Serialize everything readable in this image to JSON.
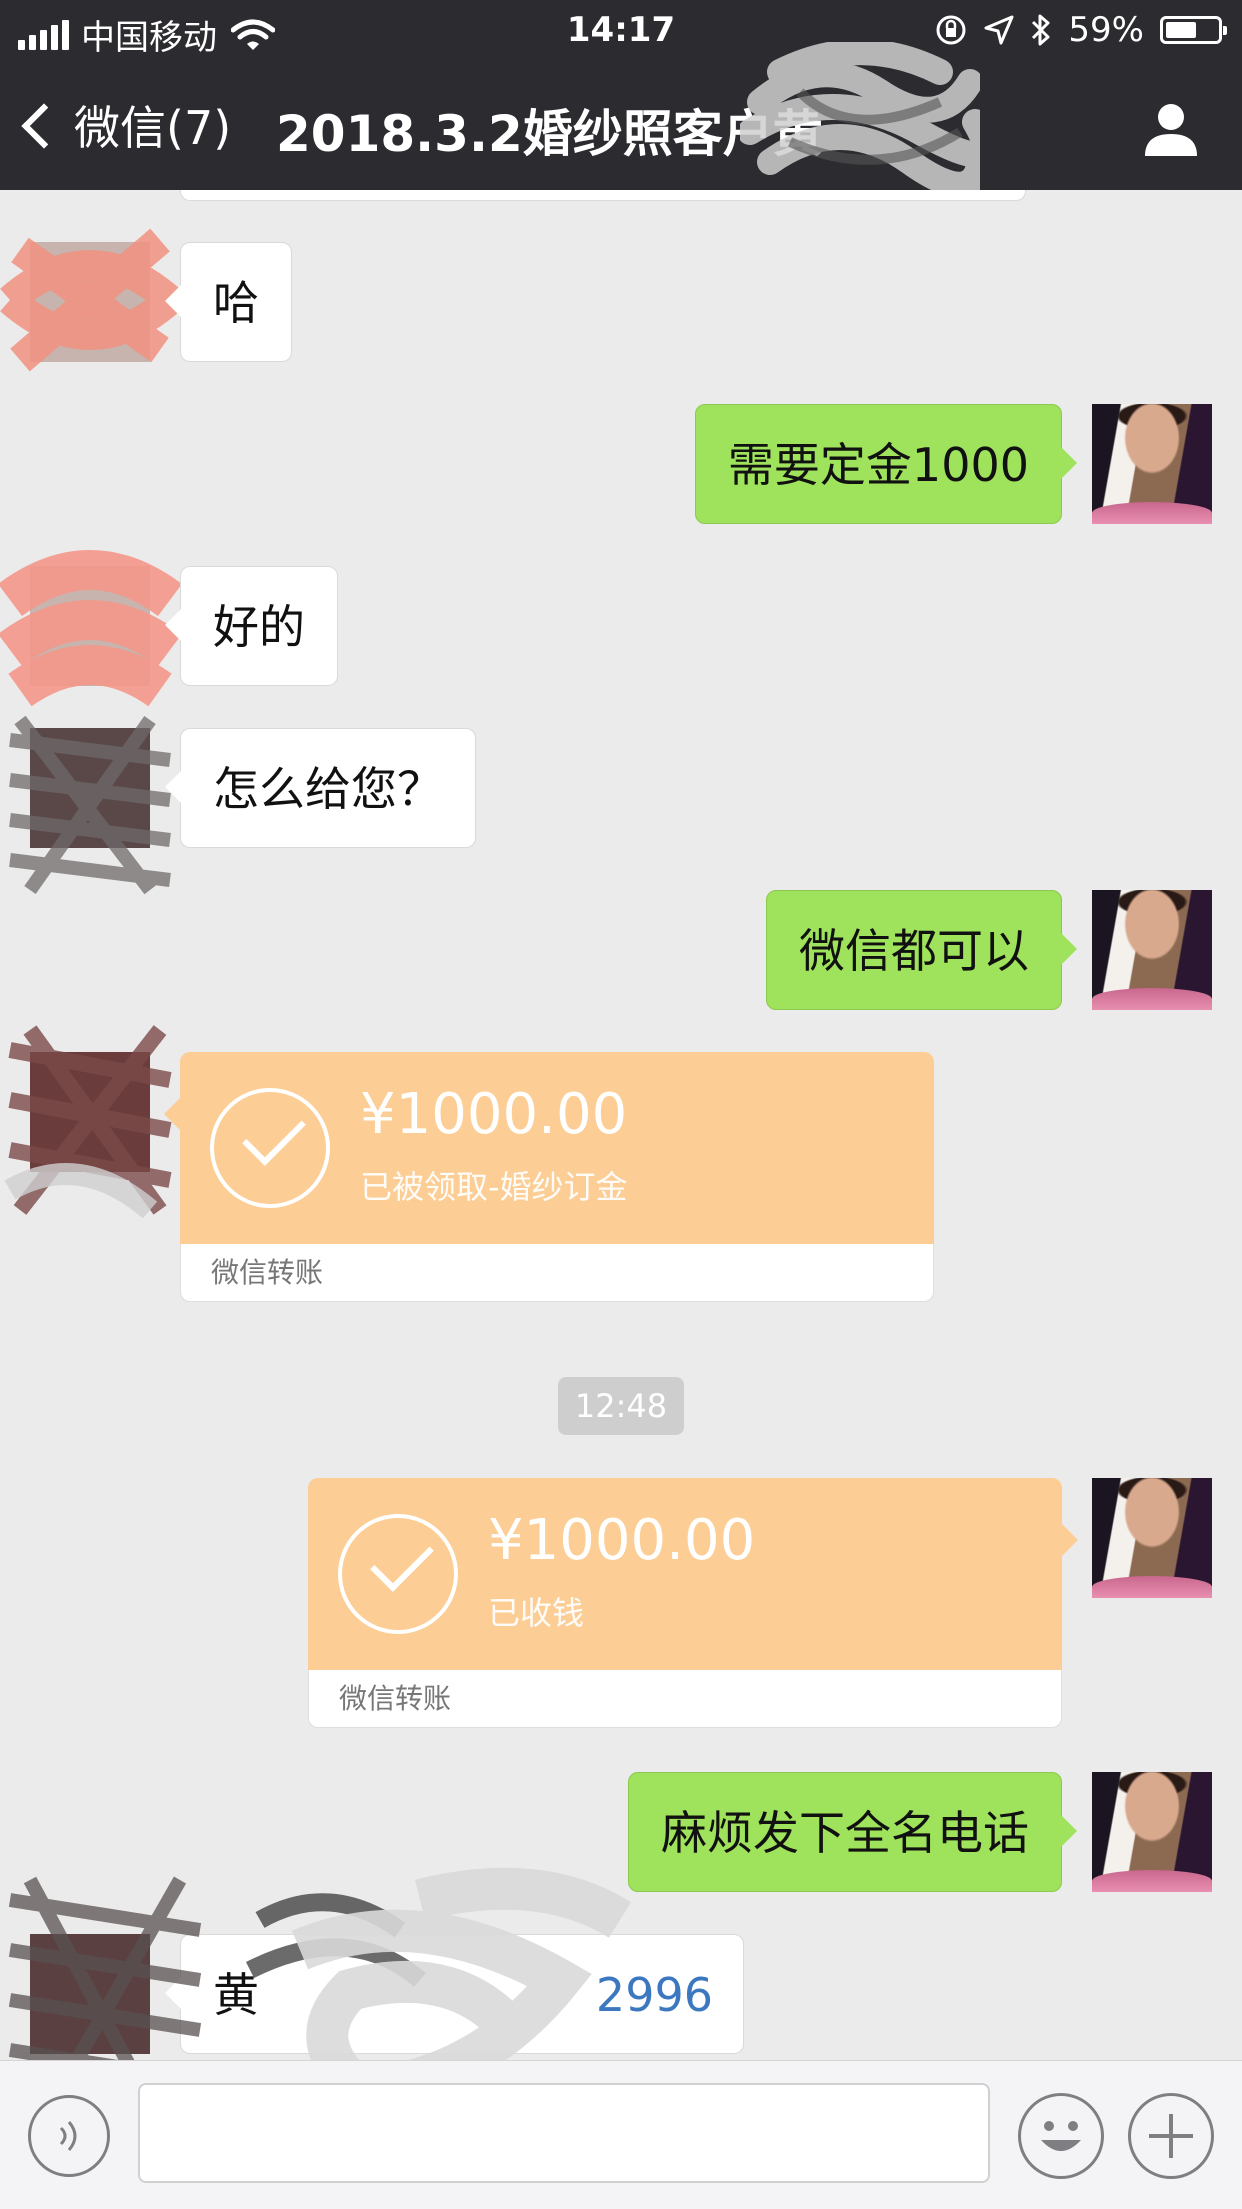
{
  "status_bar": {
    "carrier": "中国移动",
    "time": "14:17",
    "battery_percent": "59%",
    "battery_level": 0.59,
    "icons": [
      "signal-icon",
      "wifi-icon",
      "orientation-lock-icon",
      "location-arrow-icon",
      "bluetooth-icon",
      "battery-icon"
    ]
  },
  "nav": {
    "back_label": "微信(7)",
    "title": "2018.3.2婚纱照客户黄",
    "profile_icon": "person-icon"
  },
  "messages": [
    {
      "side": "in",
      "type": "text",
      "text": "哈"
    },
    {
      "side": "out",
      "type": "text",
      "text": "需要定金1000"
    },
    {
      "side": "in",
      "type": "text",
      "text": "好的"
    },
    {
      "side": "in",
      "type": "text",
      "text": "怎么给您？"
    },
    {
      "side": "out",
      "type": "text",
      "text": "微信都可以"
    },
    {
      "side": "in",
      "type": "transfer",
      "amount": "¥1000.00",
      "note": "已被领取-婚纱订金",
      "footer": "微信转账"
    },
    {
      "type": "timestamp",
      "text": "12:48"
    },
    {
      "side": "out",
      "type": "transfer",
      "amount": "¥1000.00",
      "note": "已收钱",
      "footer": "微信转账"
    },
    {
      "side": "out",
      "type": "text",
      "text": "麻烦发下全名电话"
    },
    {
      "side": "in",
      "type": "text",
      "name_prefix": "黄",
      "phone_suffix": "2996"
    }
  ],
  "input_bar": {
    "placeholder": "",
    "icons": [
      "voice-icon",
      "emoji-icon",
      "plus-icon"
    ]
  },
  "colors": {
    "nav_background": "#2b2b30",
    "chat_background": "#ebebeb",
    "outgoing_bubble": "#9fe25b",
    "incoming_bubble": "#ffffff",
    "transfer_card": "#fcce95",
    "phone_link": "#3c78c0"
  }
}
